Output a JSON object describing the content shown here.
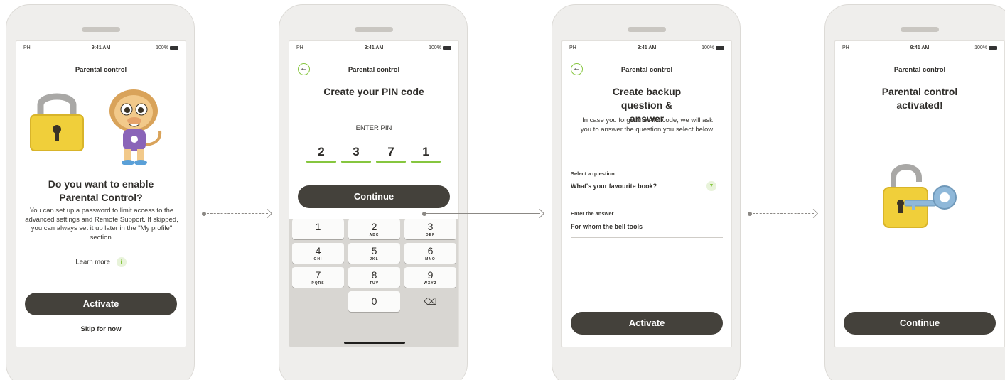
{
  "status": {
    "carrier": "PH",
    "time": "9:41 AM",
    "battery": "100%"
  },
  "screen1": {
    "header": "Parental control",
    "title": "Do you want to enable Parental Control?",
    "body": "You can set up a password to limit access to the advanced settings and Remote Support. If skipped, you can always set it up later in the \"My profile\" section.",
    "learn_more": "Learn more",
    "primary_button": "Activate",
    "secondary_link": "Skip for now"
  },
  "screen2": {
    "header": "Parental control",
    "title": "Create your PIN code",
    "pin_label": "ENTER PIN",
    "pin_digits": [
      "2",
      "3",
      "7",
      "1"
    ],
    "button": "Continue",
    "keys": [
      {
        "num": "1",
        "letters": ""
      },
      {
        "num": "2",
        "letters": "ABC"
      },
      {
        "num": "3",
        "letters": "DEF"
      },
      {
        "num": "4",
        "letters": "GHI"
      },
      {
        "num": "5",
        "letters": "JKL"
      },
      {
        "num": "6",
        "letters": "MNO"
      },
      {
        "num": "7",
        "letters": "PQRS"
      },
      {
        "num": "8",
        "letters": "TUV"
      },
      {
        "num": "9",
        "letters": "WXYZ"
      },
      {
        "num": "0",
        "letters": ""
      }
    ]
  },
  "screen3": {
    "header": "Parental control",
    "title": "Create backup question & answer",
    "body": "In case you forget the PIN code, we will ask you to answer the question you select below.",
    "question_label": "Select a question",
    "question_value": "What's your favourite book?",
    "answer_label": "Enter the answer",
    "answer_value": "For whom the bell tools",
    "button": "Activate"
  },
  "screen4": {
    "header": "Parental control",
    "title": "Parental control activated!",
    "button": "Continue"
  },
  "colors": {
    "accent_green": "#86c63f",
    "button_dark": "#44413b",
    "lock_yellow": "#f0cf3a",
    "key_blue": "#8fb8d9"
  }
}
